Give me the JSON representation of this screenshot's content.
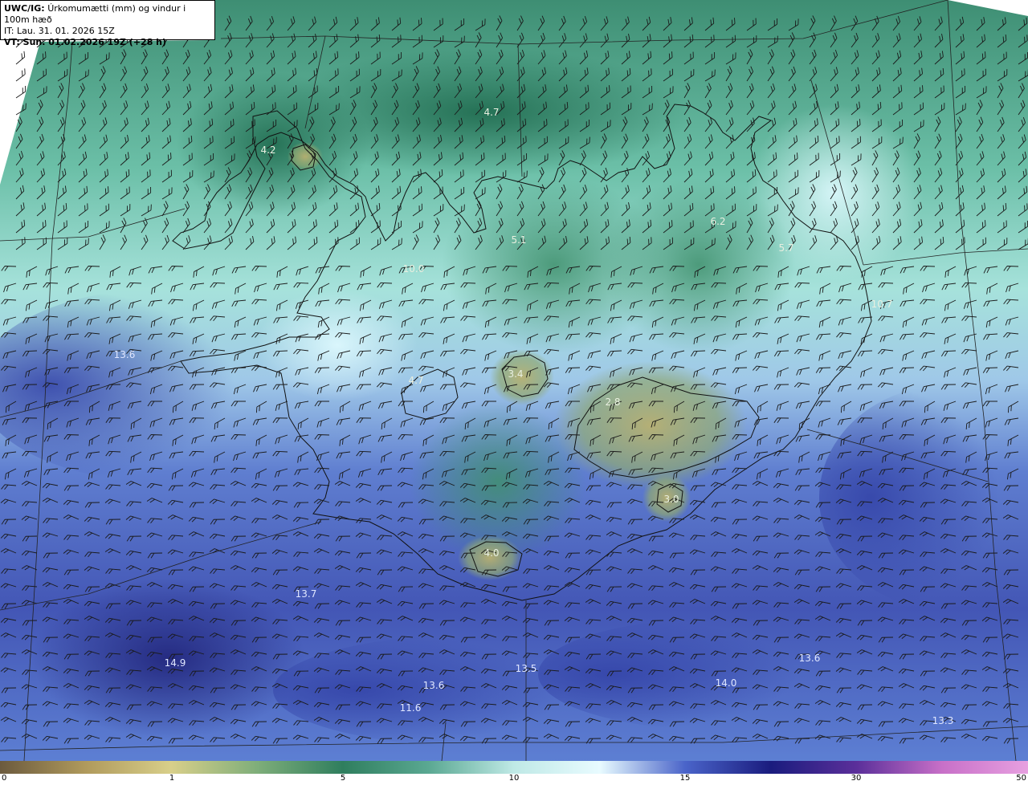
{
  "header": {
    "product_code": "UWC/IG:",
    "title": "Úrkomumætti (mm) og vindur i 100m hæð",
    "issue_prefix": "IT:",
    "issue_time": "Lau. 31. 01. 2026 15Z",
    "valid_prefix": "VT:",
    "valid_time": "Sun. 01.02.2026 19Z (+28 h)"
  },
  "field_labels": [
    {
      "text": "4.7"
    },
    {
      "text": "4.2"
    },
    {
      "text": "5.1"
    },
    {
      "text": "6.2"
    },
    {
      "text": "5.7"
    },
    {
      "text": "10.0"
    },
    {
      "text": "13.6"
    },
    {
      "text": "4.7"
    },
    {
      "text": "3.4"
    },
    {
      "text": "2.8"
    },
    {
      "text": "3.0"
    },
    {
      "text": "4.0"
    },
    {
      "text": "13.7"
    },
    {
      "text": "14.9"
    },
    {
      "text": "13.5"
    },
    {
      "text": "13.6"
    },
    {
      "text": "11.6"
    },
    {
      "text": "14.0"
    },
    {
      "text": "13.6"
    },
    {
      "text": "13.3"
    },
    {
      "text": "10.7"
    }
  ],
  "colorbar": {
    "ticks": [
      "0",
      "1",
      "5",
      "10",
      "15",
      "30",
      "50"
    ],
    "colors": [
      "#6b5a3e",
      "#b09a5c",
      "#d8cf8a",
      "#7fae7a",
      "#2f7e5e",
      "#5aa892",
      "#bfe9e6",
      "#e8fbff",
      "#4a64c9",
      "#1a1c7e",
      "#5b2f9a",
      "#c870c8",
      "#e7a0e0"
    ]
  }
}
